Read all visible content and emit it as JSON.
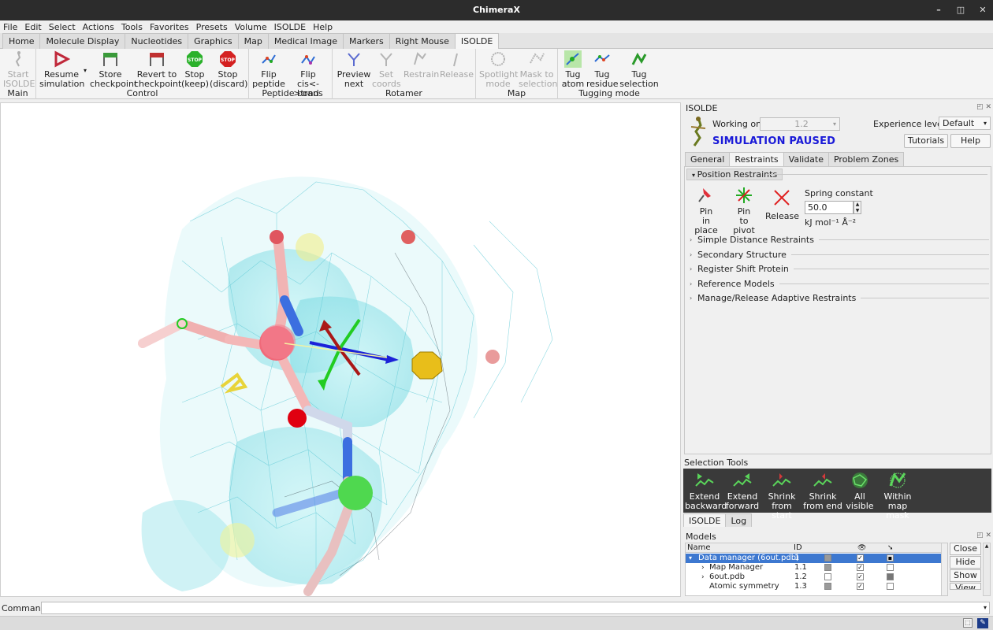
{
  "window": {
    "title": "ChimeraX"
  },
  "menu": [
    "File",
    "Edit",
    "Select",
    "Actions",
    "Tools",
    "Favorites",
    "Presets",
    "Volume",
    "ISOLDE",
    "Help"
  ],
  "ribbon_tabs": [
    "Home",
    "Molecule Display",
    "Nucleotides",
    "Graphics",
    "Map",
    "Medical Image",
    "Markers",
    "Right Mouse",
    "ISOLDE"
  ],
  "active_ribbon_tab": "ISOLDE",
  "ribbon": {
    "groups": {
      "main": "Main",
      "control": "Control",
      "peptide": "Peptide bond",
      "rotamer": "Rotamer",
      "map": "Map",
      "tugging": "Tugging mode"
    },
    "buttons": {
      "start_isolde": [
        "Start",
        "ISOLDE"
      ],
      "resume_sim": [
        "Resume",
        "simulation"
      ],
      "store_ckpt": [
        "Store",
        "checkpoint"
      ],
      "revert_ckpt": [
        "Revert to",
        "checkpoint"
      ],
      "stop_keep": [
        "Stop",
        "(keep)"
      ],
      "stop_discard": [
        "Stop",
        "(discard)"
      ],
      "flip_peptide": [
        "Flip",
        "peptide"
      ],
      "flip_cistrans": [
        "Flip",
        "cis<->trans"
      ],
      "preview_next": [
        "Preview",
        "next"
      ],
      "set_coords": [
        "Set",
        "coords"
      ],
      "restrain": [
        "Restrain"
      ],
      "release": [
        "Release"
      ],
      "spotlight": [
        "Spotlight",
        "mode"
      ],
      "mask_sel": [
        "Mask to",
        "selection"
      ],
      "tug_atom": [
        "Tug",
        "atom"
      ],
      "tug_residue": [
        "Tug",
        "residue"
      ],
      "tug_selection": [
        "Tug",
        "selection"
      ]
    },
    "stop_icon_text": "STOP"
  },
  "isolde": {
    "panel_title": "ISOLDE",
    "working_on_label": "Working on:",
    "working_on_value": "1.2",
    "experience_label": "Experience level:",
    "experience_value": "Default",
    "status": "SIMULATION PAUSED",
    "tutorials": "Tutorials",
    "help": "Help",
    "tabs": [
      "General",
      "Restraints",
      "Validate",
      "Problem Zones"
    ],
    "active_tab": "Restraints",
    "position_restraints": {
      "header": "Position Restraints",
      "pin_place": [
        "Pin",
        "in place"
      ],
      "pin_pivot": [
        "Pin",
        "to pivot"
      ],
      "release": "Release",
      "spring_label": "Spring constant",
      "spring_value": "50.0",
      "units": "kJ mol⁻¹ Å⁻²"
    },
    "sections": [
      "Simple Distance Restraints",
      "Secondary Structure",
      "Register Shift Protein",
      "Reference Models",
      "Manage/Release Adaptive Restraints"
    ]
  },
  "selection_tools": {
    "title": "Selection Tools",
    "buttons": [
      [
        "Extend",
        "backward"
      ],
      [
        "Extend",
        "forward"
      ],
      [
        "Shrink",
        "from start"
      ],
      [
        "Shrink",
        "from end"
      ],
      [
        "All",
        "visible"
      ],
      [
        "Within",
        "map mask"
      ]
    ]
  },
  "log_tabs": [
    "ISOLDE",
    "Log"
  ],
  "models": {
    "title": "Models",
    "headers": [
      "Name",
      "ID"
    ],
    "rows": [
      {
        "name": "Data manager (6out.pdb)",
        "id": "1",
        "expand": "▾",
        "selected": true
      },
      {
        "name": "Map Manager",
        "id": "1.1",
        "expand": "›",
        "selected": false
      },
      {
        "name": "6out.pdb",
        "id": "1.2",
        "expand": "›",
        "selected": false
      },
      {
        "name": "Atomic symmetry",
        "id": "1.3",
        "expand": "",
        "selected": false
      }
    ],
    "buttons": [
      "Close",
      "Hide",
      "Show",
      "View"
    ]
  },
  "command": {
    "label": "Command:"
  }
}
